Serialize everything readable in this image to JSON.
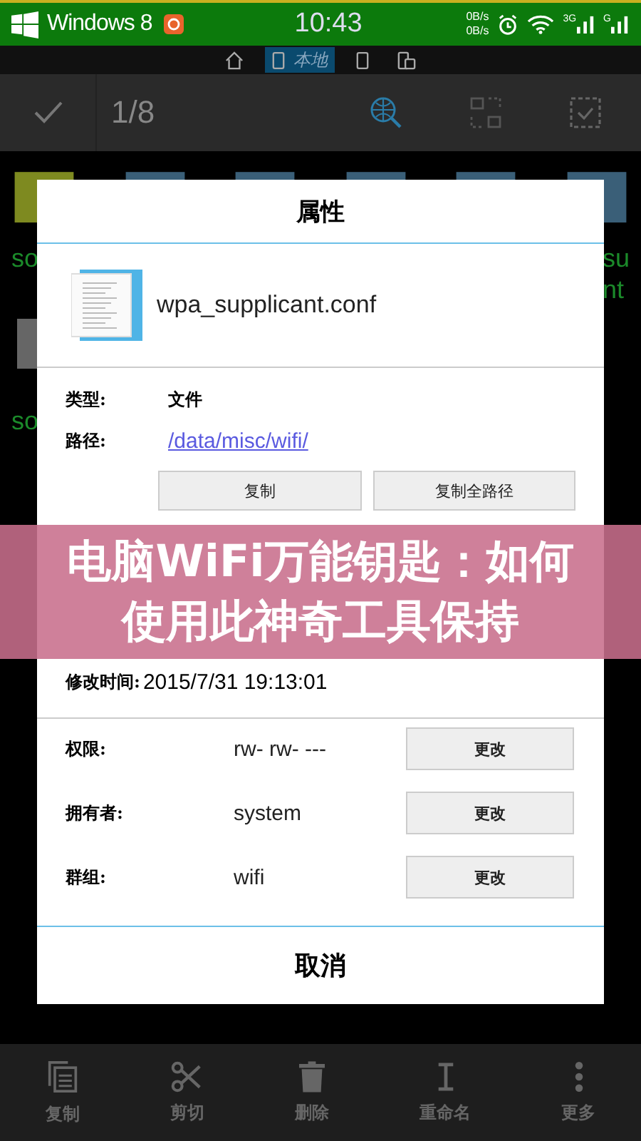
{
  "status_bar": {
    "os_label": "Windows 8",
    "time": "10:43",
    "net_up": "0B/s",
    "net_down": "0B/s",
    "networks": [
      {
        "label": "3G"
      },
      {
        "label": "G"
      }
    ]
  },
  "location_bar": {
    "tabs": [
      {
        "kind": "home",
        "selected": false
      },
      {
        "kind": "phone",
        "label": "本地",
        "selected": true
      },
      {
        "kind": "phone",
        "selected": false
      },
      {
        "kind": "devices",
        "selected": false
      }
    ]
  },
  "action_bar": {
    "count": "1/8"
  },
  "background_labels": {
    "left": [
      "so",
      "so"
    ],
    "right": [
      "su",
      "nt"
    ]
  },
  "dialog": {
    "title": "属性",
    "file_name": "wpa_supplicant.conf",
    "type_label": "类型:",
    "type_value": "文件",
    "path_label": "路径:",
    "path_value": "/data/misc/wifi/",
    "path_buttons": [
      "复制",
      "复制全路径"
    ],
    "modified_label": "修改时间:",
    "modified_value": "2015/7/31 19:13:01",
    "owner_rows": [
      {
        "label": "权限:",
        "value": "rw- rw- ---",
        "button": "更改"
      },
      {
        "label": "拥有者:",
        "value": "system",
        "button": "更改"
      },
      {
        "label": "群组:",
        "value": "wifi",
        "button": "更改"
      }
    ],
    "cancel": "取消"
  },
  "overlay_title": "电脑WiFi万能钥匙：如何使用此神奇工具保持",
  "bottom_bar": [
    {
      "kind": "copy",
      "label": "复制"
    },
    {
      "kind": "cut",
      "label": "剪切"
    },
    {
      "kind": "delete",
      "label": "删除"
    },
    {
      "kind": "rename",
      "label": "重命名"
    },
    {
      "kind": "more",
      "label": "更多"
    }
  ]
}
